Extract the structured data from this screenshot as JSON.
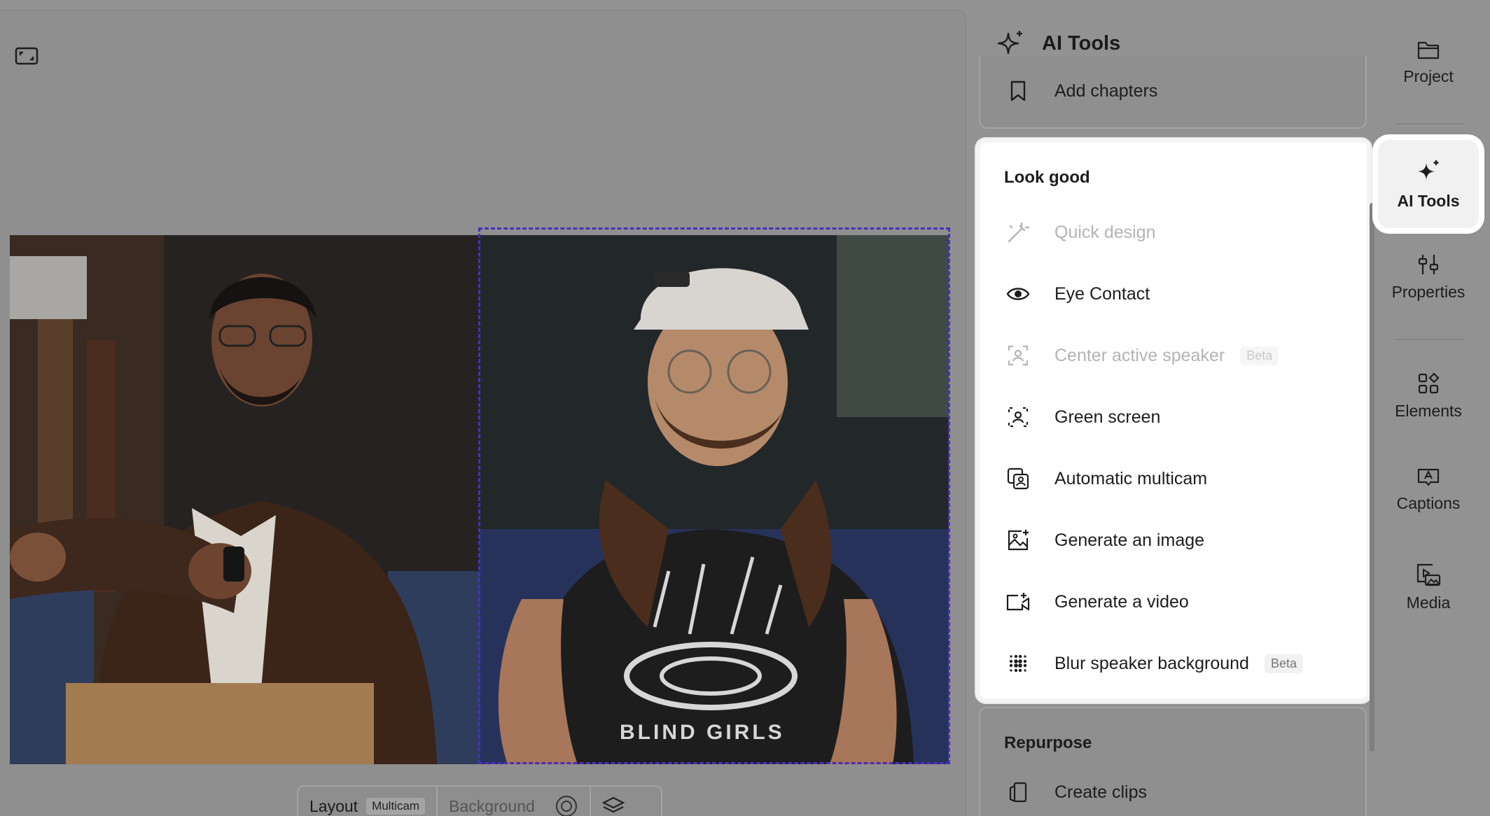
{
  "canvas": {
    "expand_icon": "expand-icon",
    "layout_bar": {
      "layout_label": "Layout",
      "layout_tag": "Multicam",
      "background_label": "Background"
    }
  },
  "panel": {
    "title": "AI Tools",
    "top_item": "Add chapters",
    "look_good": {
      "title": "Look good",
      "items": [
        {
          "label": "Quick design",
          "icon": "magic-wand-icon",
          "disabled": true
        },
        {
          "label": "Eye Contact",
          "icon": "eye-icon",
          "disabled": false
        },
        {
          "label": "Center active speaker",
          "icon": "center-speaker-icon",
          "disabled": true,
          "badge": "Beta"
        },
        {
          "label": "Green screen",
          "icon": "green-screen-icon",
          "disabled": false
        },
        {
          "label": "Automatic multicam",
          "icon": "multicam-icon",
          "disabled": false
        },
        {
          "label": "Generate an image",
          "icon": "generate-image-icon",
          "disabled": false
        },
        {
          "label": "Generate a video",
          "icon": "generate-video-icon",
          "disabled": false
        },
        {
          "label": "Blur speaker background",
          "icon": "blur-icon",
          "disabled": false,
          "badge": "Beta"
        }
      ]
    },
    "repurpose": {
      "title": "Repurpose",
      "items": [
        {
          "label": "Create clips",
          "icon": "clips-icon"
        }
      ]
    }
  },
  "sidebar": {
    "items": [
      {
        "label": "Project",
        "icon": "folder-icon"
      },
      {
        "label": "AI Tools",
        "icon": "sparkle-icon",
        "active": true
      },
      {
        "label": "Properties",
        "icon": "sliders-icon"
      },
      {
        "label": "Elements",
        "icon": "shapes-icon"
      },
      {
        "label": "Captions",
        "icon": "captions-icon"
      },
      {
        "label": "Media",
        "icon": "media-icon"
      }
    ]
  },
  "colors": {
    "selection": "#4b2fb8",
    "overlay": "#929292",
    "panel_bg": "#ffffff"
  }
}
